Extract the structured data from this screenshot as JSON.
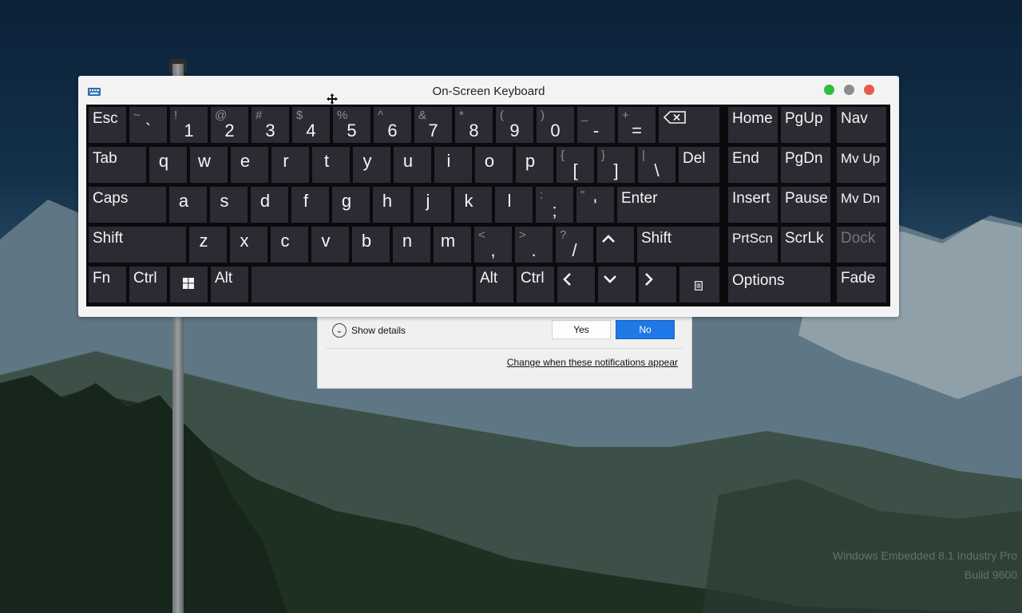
{
  "window": {
    "title": "On-Screen Keyboard",
    "app_icon": "keyboard-icon",
    "move_icon": "move-cursor-icon",
    "window_controls": [
      "green-dot",
      "gray-dot",
      "red-dot"
    ]
  },
  "keyboard": {
    "rows": [
      [
        {
          "label": "Esc"
        },
        {
          "shift": "~",
          "main": "`"
        },
        {
          "shift": "!",
          "main": "1"
        },
        {
          "shift": "@",
          "main": "2"
        },
        {
          "shift": "#",
          "main": "3"
        },
        {
          "shift": "$",
          "main": "4"
        },
        {
          "shift": "%",
          "main": "5"
        },
        {
          "shift": "^",
          "main": "6"
        },
        {
          "shift": "&",
          "main": "7"
        },
        {
          "shift": "*",
          "main": "8"
        },
        {
          "shift": "(",
          "main": "9"
        },
        {
          "shift": ")",
          "main": "0"
        },
        {
          "shift": "_",
          "main": "-"
        },
        {
          "shift": "+",
          "main": "="
        },
        {
          "icon": "backspace-icon"
        }
      ],
      [
        {
          "label": "Tab"
        },
        {
          "main": "q"
        },
        {
          "main": "w"
        },
        {
          "main": "e"
        },
        {
          "main": "r"
        },
        {
          "main": "t"
        },
        {
          "main": "y"
        },
        {
          "main": "u"
        },
        {
          "main": "i"
        },
        {
          "main": "o"
        },
        {
          "main": "p"
        },
        {
          "shift": "{",
          "main": "["
        },
        {
          "shift": "}",
          "main": "]"
        },
        {
          "shift": "|",
          "main": "\\"
        },
        {
          "label": "Del"
        }
      ],
      [
        {
          "label": "Caps"
        },
        {
          "main": "a"
        },
        {
          "main": "s"
        },
        {
          "main": "d"
        },
        {
          "main": "f"
        },
        {
          "main": "g"
        },
        {
          "main": "h"
        },
        {
          "main": "j"
        },
        {
          "main": "k"
        },
        {
          "main": "l"
        },
        {
          "shift": ":",
          "main": ";"
        },
        {
          "shift": "\"",
          "main": "'"
        },
        {
          "label": "Enter"
        }
      ],
      [
        {
          "label": "Shift"
        },
        {
          "main": "z"
        },
        {
          "main": "x"
        },
        {
          "main": "c"
        },
        {
          "main": "v"
        },
        {
          "main": "b"
        },
        {
          "main": "n"
        },
        {
          "main": "m"
        },
        {
          "shift": "<",
          "main": ","
        },
        {
          "shift": ">",
          "main": "."
        },
        {
          "shift": "?",
          "main": "/"
        },
        {
          "icon": "arrow-up-icon"
        },
        {
          "label": "Shift"
        }
      ],
      [
        {
          "label": "Fn"
        },
        {
          "label": "Ctrl"
        },
        {
          "icon": "windows-icon"
        },
        {
          "label": "Alt"
        },
        {
          "label": ""
        },
        {
          "label": "Alt"
        },
        {
          "label": "Ctrl"
        },
        {
          "icon": "arrow-left-icon"
        },
        {
          "icon": "arrow-down-icon"
        },
        {
          "icon": "arrow-right-icon"
        },
        {
          "icon": "menu-key-icon"
        }
      ]
    ],
    "nav_block": [
      [
        {
          "label": "Home"
        },
        {
          "label": "PgUp"
        },
        {
          "label": "Nav"
        }
      ],
      [
        {
          "label": "End"
        },
        {
          "label": "PgDn"
        },
        {
          "label": "Mv Up"
        }
      ],
      [
        {
          "label": "Insert"
        },
        {
          "label": "Pause"
        },
        {
          "label": "Mv Dn"
        }
      ],
      [
        {
          "label": "PrtScn"
        },
        {
          "label": "ScrLk"
        },
        {
          "label": "Dock",
          "disabled": true
        }
      ],
      [
        {
          "label": "Options"
        },
        {
          "label": "Fade"
        }
      ]
    ]
  },
  "notification": {
    "show_details": "Show details",
    "yes_label": "Yes",
    "no_label": "No",
    "change_link": "Change when these notifications appear"
  },
  "desktop": {
    "watermark_line1": "Windows Embedded 8.1 Industry Pro",
    "watermark_line2": "Build 9600"
  },
  "colors": {
    "key_bg": "#2c2b34",
    "keyboard_bg": "#0b0b0d",
    "no_button": "#1e78e6",
    "close_dot": "#e55a4e",
    "min_dot": "#8b8b8b",
    "max_dot": "#2dbe3c"
  }
}
